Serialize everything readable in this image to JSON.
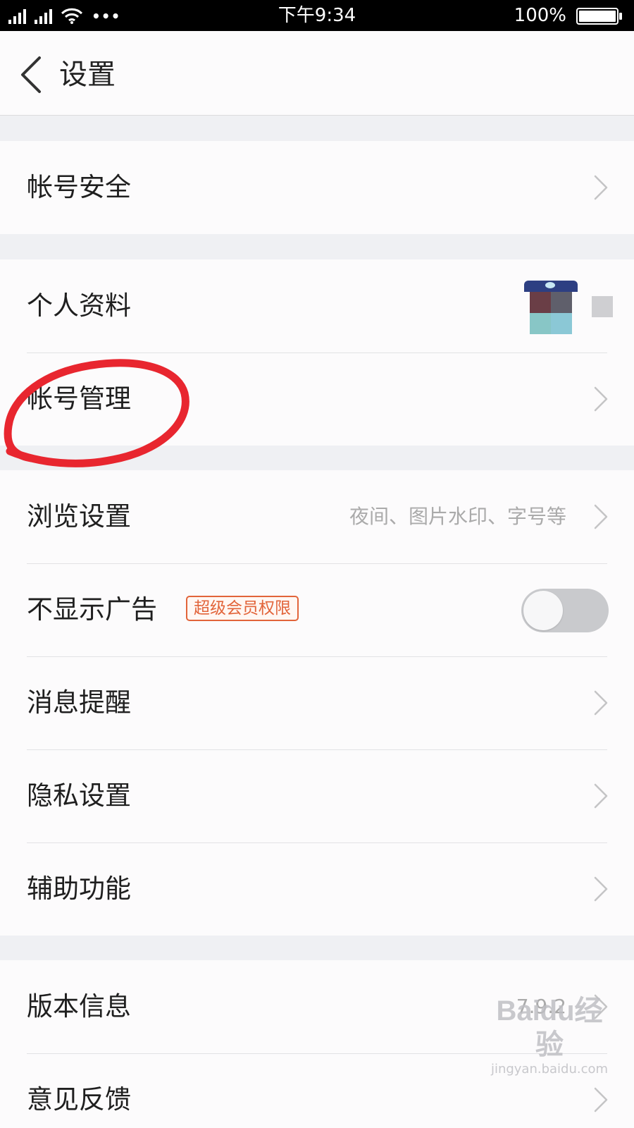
{
  "status_bar": {
    "time": "下午9:34",
    "battery_percent": "100%",
    "more_glyph": "•••",
    "icons": [
      "signal-icon",
      "signal-icon",
      "wifi-icon",
      "battery-icon"
    ]
  },
  "header": {
    "title": "设置",
    "back_icon": "chevron-left-icon"
  },
  "groups": [
    {
      "rows": [
        {
          "label": "帐号安全",
          "type": "nav"
        }
      ]
    },
    {
      "rows": [
        {
          "label": "个人资料",
          "type": "avatar"
        },
        {
          "label": "帐号管理",
          "type": "nav",
          "annotated": true
        }
      ]
    },
    {
      "rows": [
        {
          "label": "浏览设置",
          "value": "夜间、图片水印、字号等",
          "type": "nav"
        },
        {
          "label": "不显示广告",
          "badge": "超级会员权限",
          "type": "toggle",
          "toggle_on": false
        },
        {
          "label": "消息提醒",
          "type": "nav"
        },
        {
          "label": "隐私设置",
          "type": "nav"
        },
        {
          "label": "辅助功能",
          "type": "nav"
        }
      ]
    },
    {
      "rows": [
        {
          "label": "版本信息",
          "value": "7.9.2",
          "type": "nav"
        },
        {
          "label": "意见反馈",
          "type": "nav"
        }
      ]
    }
  ],
  "colors": {
    "annotation": "#e8262f",
    "badge": "#e2643a",
    "background": "#eff0f3",
    "row_background": "#fcfbfc"
  },
  "watermark": {
    "logo": "Baidu经验",
    "url": "jingyan.baidu.com"
  }
}
